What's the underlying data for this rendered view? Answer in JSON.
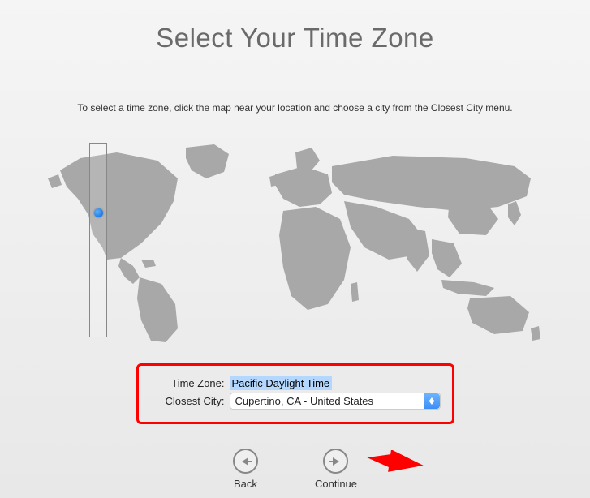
{
  "title": "Select Your Time Zone",
  "instruction": "To select a time zone, click the map near your location and choose a city from the Closest City menu.",
  "form": {
    "timezone_label": "Time Zone:",
    "timezone_value": "Pacific Daylight Time",
    "city_label": "Closest City:",
    "city_value": "Cupertino, CA - United States"
  },
  "nav": {
    "back_label": "Back",
    "continue_label": "Continue"
  }
}
